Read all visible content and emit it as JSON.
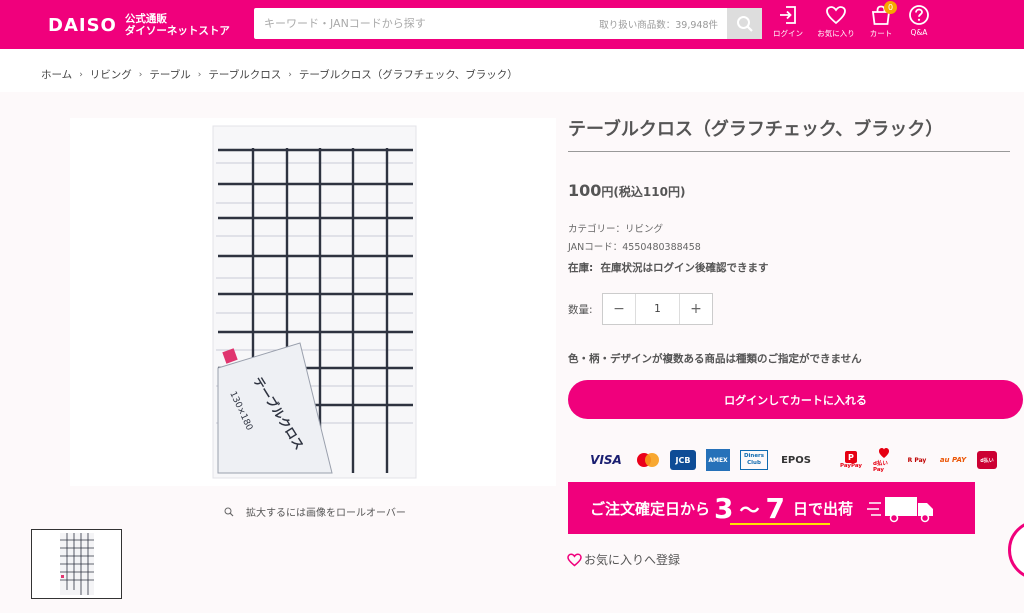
{
  "header": {
    "logo_mark": "DAISO",
    "logo_sub_line1": "公式通販",
    "logo_sub_line2": "ダイソーネットストア",
    "search_placeholder": "キーワード・JANコードから探す",
    "search_count": "取り扱い商品数：39,948件",
    "nav": {
      "login": "ログイン",
      "favorites": "お気に入り",
      "cart": "カート",
      "cart_count": "0",
      "qa": "Q&A"
    }
  },
  "breadcrumb": [
    "ホーム",
    "リビング",
    "テーブル",
    "テーブルクロス",
    "テーブルクロス（グラフチェック、ブラック）"
  ],
  "gallery": {
    "zoom_hint": "拡大するには画像をロールオーバー",
    "package_label": "テーブルクロス",
    "package_size": "130×180"
  },
  "product": {
    "title": "テーブルクロス（グラフチェック、ブラック）",
    "price": "100",
    "price_unit": "円",
    "price_tax": "(税込110円)",
    "category": "カテゴリー：リビング",
    "jan": "JANコード：4550480388458",
    "stock_label": "在庫:",
    "stock_text": "在庫状況はログイン後確認できます",
    "qty_label": "数量:",
    "qty_minus": "−",
    "qty_value": "1",
    "qty_plus": "+",
    "notice": "色・柄・デザインが複数ある商品は種類のご指定ができません",
    "cart_button": "ログインしてカートに入れる",
    "favorite_link": "お気に入りへ登録"
  },
  "payments": [
    "VISA",
    "mastercard",
    "JCB",
    "AMEX",
    "Diners Club",
    "EPOS",
    "PayPay",
    "d払い Pay",
    "R Pay",
    "au PAY",
    "d払い"
  ],
  "shipping": {
    "prefix": "ご注文確定日から",
    "from": "3",
    "tilde": "〜",
    "to": "7",
    "suffix": "日で出荷"
  },
  "colors": {
    "brand": "#f0007c",
    "badge": "#f6a800",
    "highlight": "#ffe100"
  }
}
